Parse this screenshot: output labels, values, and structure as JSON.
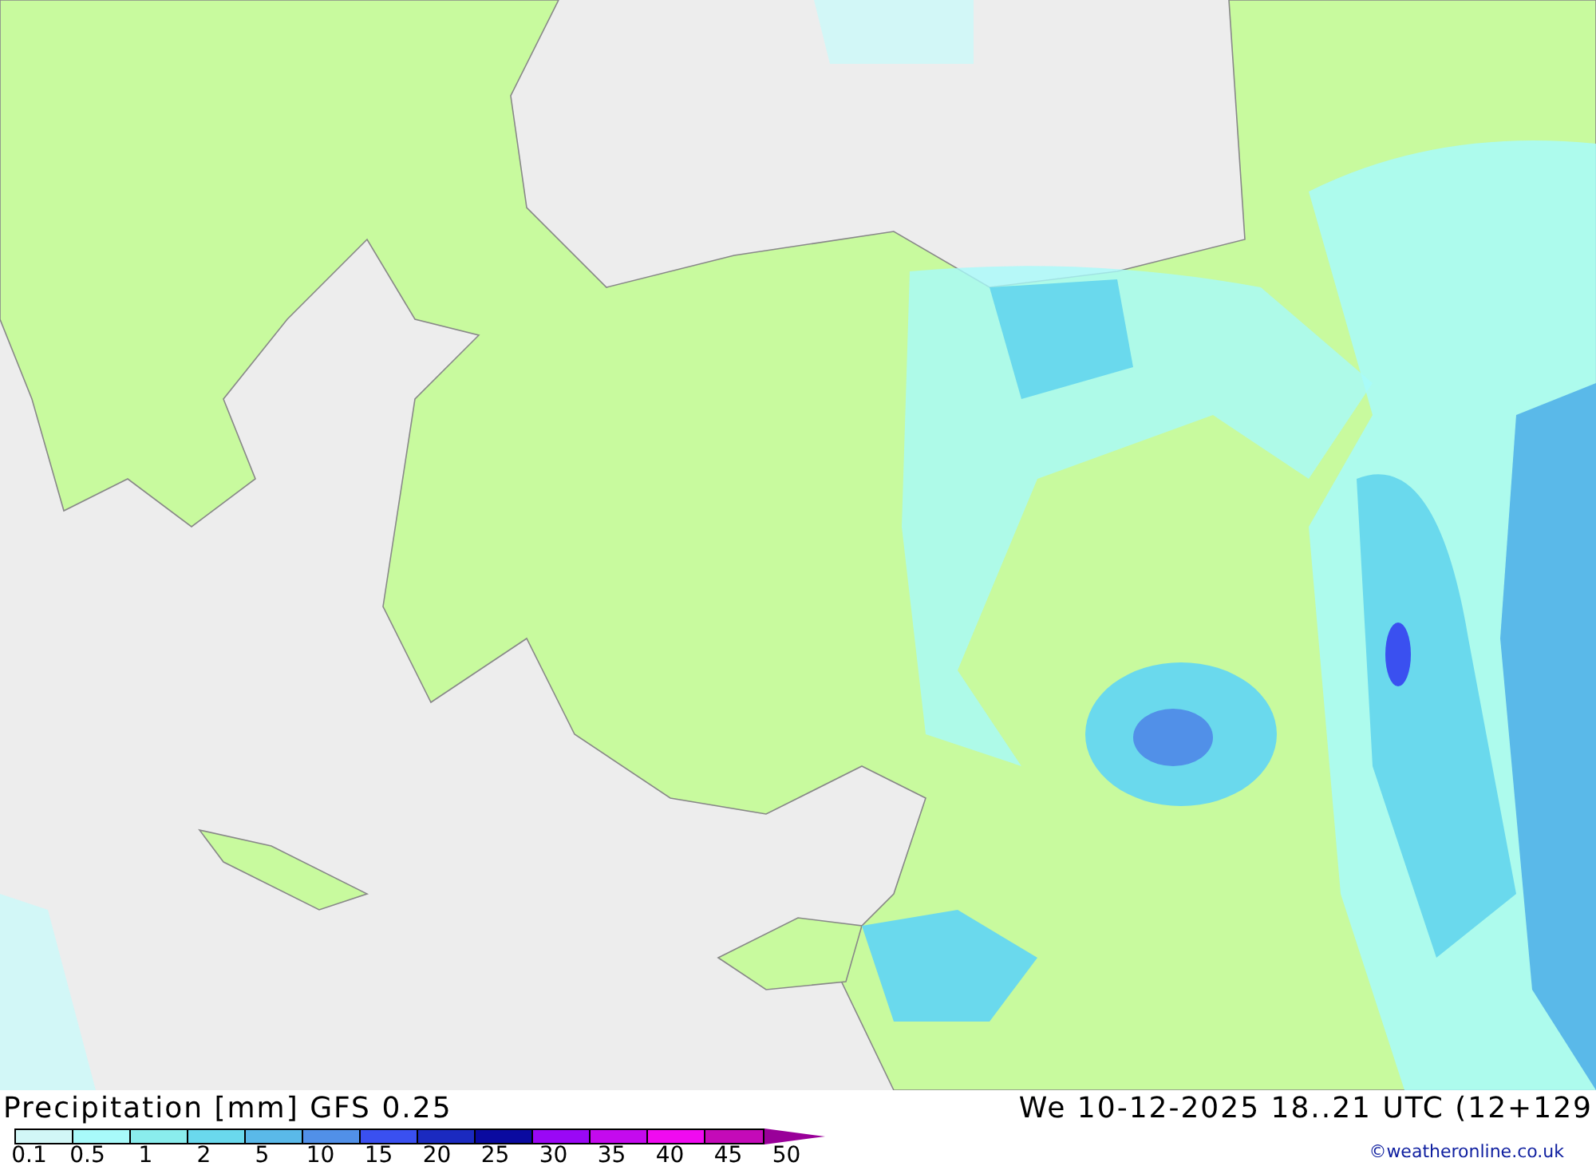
{
  "title": "Precipitation [mm] GFS 0.25",
  "valid_time": "We 10-12-2025 18..21 UTC (12+129",
  "legend": {
    "bins": [
      {
        "color": "#d2f7f7"
      },
      {
        "color": "#a8fafa"
      },
      {
        "color": "#8aeded"
      },
      {
        "color": "#6ad9ed"
      },
      {
        "color": "#5ab9e9"
      },
      {
        "color": "#5190e8"
      },
      {
        "color": "#3a50f0"
      },
      {
        "color": "#1b2ac0"
      },
      {
        "color": "#0a0aa0"
      },
      {
        "color": "#9a08f5"
      },
      {
        "color": "#c40aee"
      },
      {
        "color": "#f00af0"
      },
      {
        "color": "#c40ab8"
      }
    ],
    "ticks": [
      "0.1",
      "0.5",
      "1",
      "2",
      "5",
      "10",
      "15",
      "20",
      "25",
      "30",
      "35",
      "40",
      "45",
      "50"
    ]
  },
  "credit": "©weatheronline.co.uk"
}
